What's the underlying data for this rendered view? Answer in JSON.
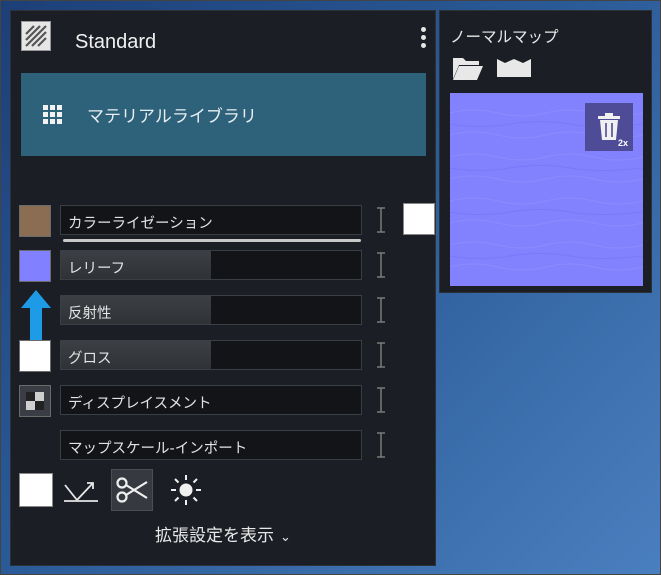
{
  "material": {
    "name": "Standard"
  },
  "library": {
    "label": "マテリアルライブラリ"
  },
  "channels": [
    {
      "label": "カラーライゼーション",
      "swatch_color": "#8a6d52",
      "fill": 0.0
    },
    {
      "label": "レリーフ",
      "swatch_color": "#8181ff",
      "fill": 0.5
    },
    {
      "label": "反射性",
      "swatch_color": "",
      "fill": 0.5
    },
    {
      "label": "グロス",
      "swatch_color": "#ffffff",
      "fill": 0.5
    },
    {
      "label": "ディスプレイスメント",
      "swatch_color": "",
      "fill": 0.0
    },
    {
      "label": "マップスケール-インポート",
      "swatch_color": "",
      "fill": 0.0
    }
  ],
  "advanced": {
    "label": "拡張設定を表示"
  },
  "normal_map": {
    "title": "ノーマルマップ",
    "preview_color": "#8282ff",
    "badge": "2x"
  },
  "colors": {
    "library_bg": "#2d627a",
    "arrow": "#1e9be6"
  }
}
